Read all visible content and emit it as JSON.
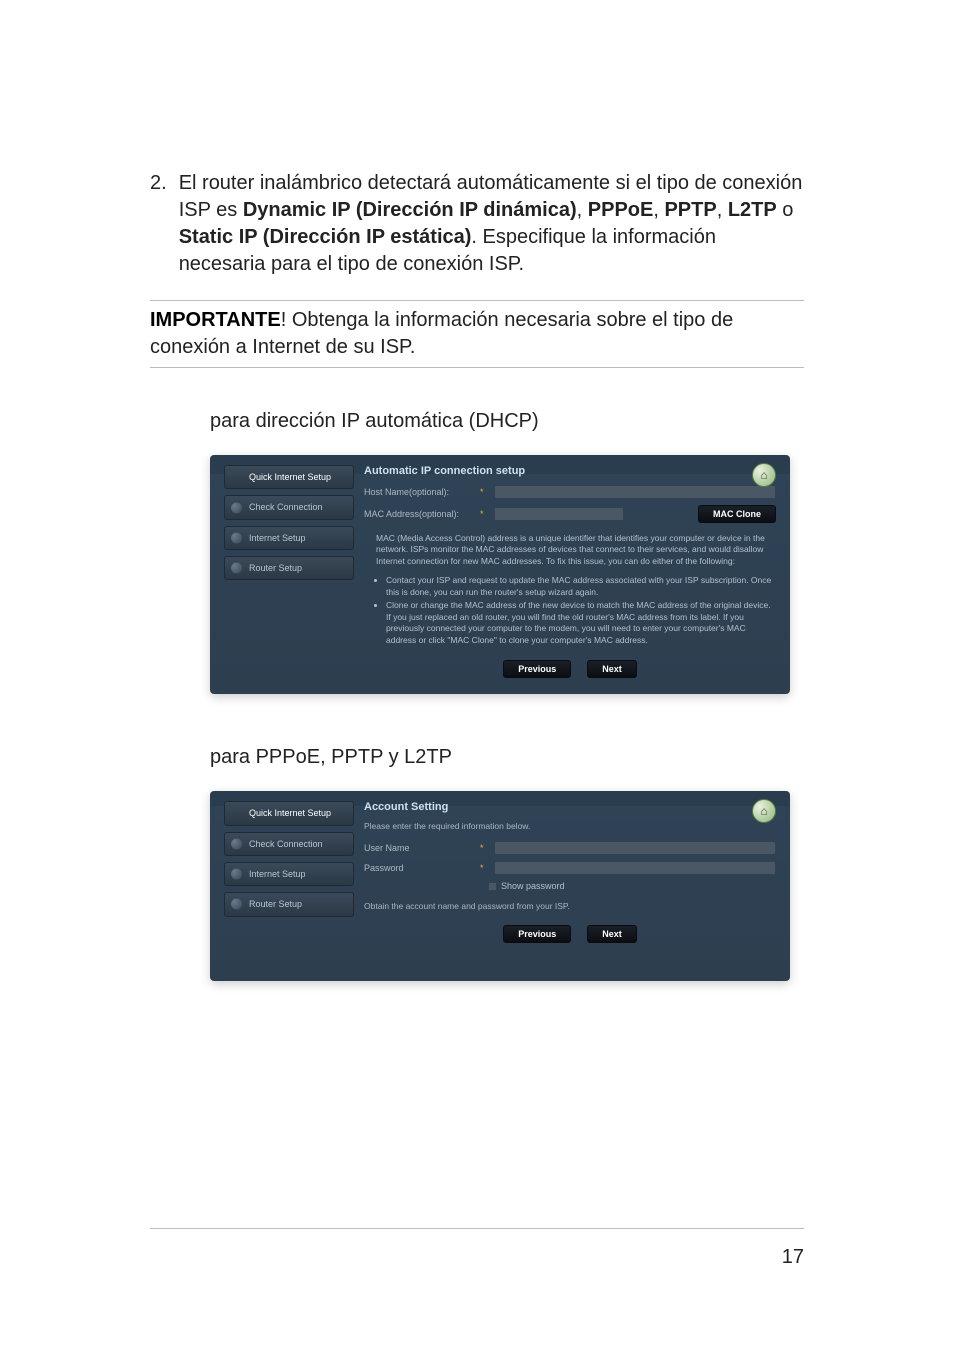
{
  "paragraph": {
    "number": "2.",
    "pre": "El router inalámbrico detectará automáticamente si el tipo de conexión ISP es ",
    "b1": "Dynamic IP (Dirección IP dinámica)",
    "sep1": ", ",
    "b2": "PPPoE",
    "sep2": ", ",
    "b3": "PPTP",
    "sep3": ", ",
    "b4": "L2TP",
    "sep4": " o ",
    "b5": "Static IP (Dirección IP estática)",
    "post": ". Especifique la información necesaria para el tipo de conexión ISP."
  },
  "note": {
    "label": "IMPORTANTE",
    "excl": "!",
    "text": "    Obtenga la información necesaria sobre el tipo de conexión a Internet de su ISP."
  },
  "heading1": "para dirección IP automática (DHCP)",
  "heading2": "para PPPoE, PPTP y L2TP",
  "panel1": {
    "title": "Automatic IP connection setup",
    "sidebar": {
      "qis": "Quick Internet Setup",
      "check": "Check Connection",
      "internet": "Internet Setup",
      "router": "Router Setup"
    },
    "host_label": "Host Name(optional):",
    "mac_label": "MAC Address(optional):",
    "mac_clone": "MAC Clone",
    "info": "MAC (Media Access Control) address is a unique identifier that identifies your computer or device in the network. ISPs monitor the MAC addresses of devices that connect to their services, and would disallow Internet connection for new MAC addresses. To fix this issue, you can do either of the following:",
    "bullet1": "Contact your ISP and request to update the MAC address associated with your ISP subscription. Once this is done, you can run the router's setup wizard again.",
    "bullet2": "Clone or change the MAC address of the new device to match the MAC address of the original device. If you just replaced an old router, you will find the old router's MAC address from its label. If you previously connected your computer to the modem, you will need to enter your computer's MAC address or click \"MAC Clone\" to clone your computer's MAC address.",
    "previous": "Previous",
    "next": "Next"
  },
  "panel2": {
    "title": "Account Setting",
    "sidebar": {
      "qis": "Quick Internet Setup",
      "check": "Check Connection",
      "internet": "Internet Setup",
      "router": "Router Setup"
    },
    "prompt": "Please enter the required information below.",
    "user_label": "User Name",
    "pass_label": "Password",
    "show_pass": "Show password",
    "helper": "Obtain the account name and password from your ISP.",
    "previous": "Previous",
    "next": "Next"
  },
  "page_number": "17"
}
